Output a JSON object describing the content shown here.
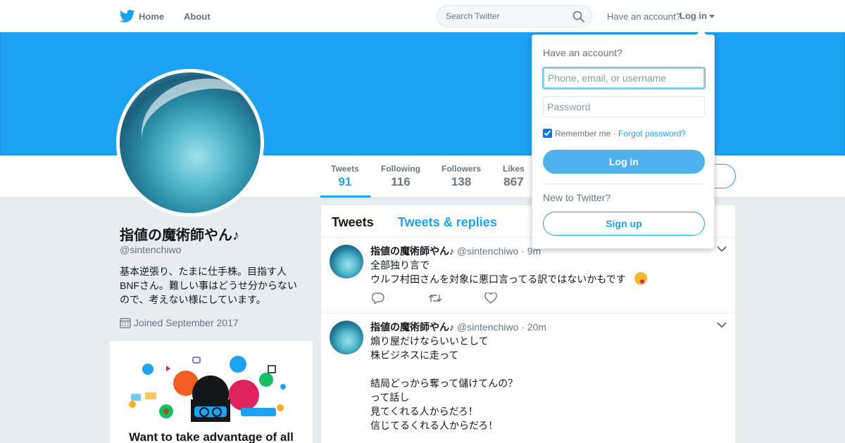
{
  "nav": {
    "home_label": "Home",
    "about_label": "About",
    "search_placeholder": "Search Twitter",
    "have_account": "Have an account?",
    "login_label": "Log in"
  },
  "profile": {
    "name": "指値の魔術師やん♪",
    "handle": "@sintenchiwo",
    "bio": "基本逆張り、たまに仕手株。目指す人BNFさん。難しい事はどうせ分からないので、考えない様にしています。",
    "joined": "Joined September 2017",
    "stats": [
      {
        "label": "Tweets",
        "value": "91"
      },
      {
        "label": "Following",
        "value": "116"
      },
      {
        "label": "Followers",
        "value": "138"
      },
      {
        "label": "Likes",
        "value": "867"
      }
    ]
  },
  "promo": {
    "title": "Want to take advantage of all"
  },
  "timeline": {
    "tabs": [
      "Tweets",
      "Tweets & replies"
    ],
    "tweets": [
      {
        "name": "指値の魔術師やん♪",
        "handle": "@sintenchiwo",
        "time": "9m",
        "text_line1": "全部独り言で",
        "text_line2": "ウルフ村田さんを対象に悪口言ってる訳ではないかもです"
      },
      {
        "name": "指値の魔術師やん♪",
        "handle": "@sintenchiwo",
        "time": "20m",
        "text": "煽り屋だけならいいとして\n株ビジネスに走って\n\n結局どっから奪って儲けてんの？\nって話し\n見てくれる人からだろ！\n信じてるくれる人からだろ！"
      }
    ]
  },
  "login_dropdown": {
    "title": "Have an account?",
    "username_placeholder": "Phone, email, or username",
    "password_placeholder": "Password",
    "remember_label": "Remember me",
    "separator": " · ",
    "forgot_label": "Forgot password?",
    "login_button": "Log in",
    "new_label": "New to Twitter?",
    "signup_button": "Sign up"
  },
  "colors": {
    "brand": "#1da1f2",
    "background": "#e6ecf0"
  }
}
